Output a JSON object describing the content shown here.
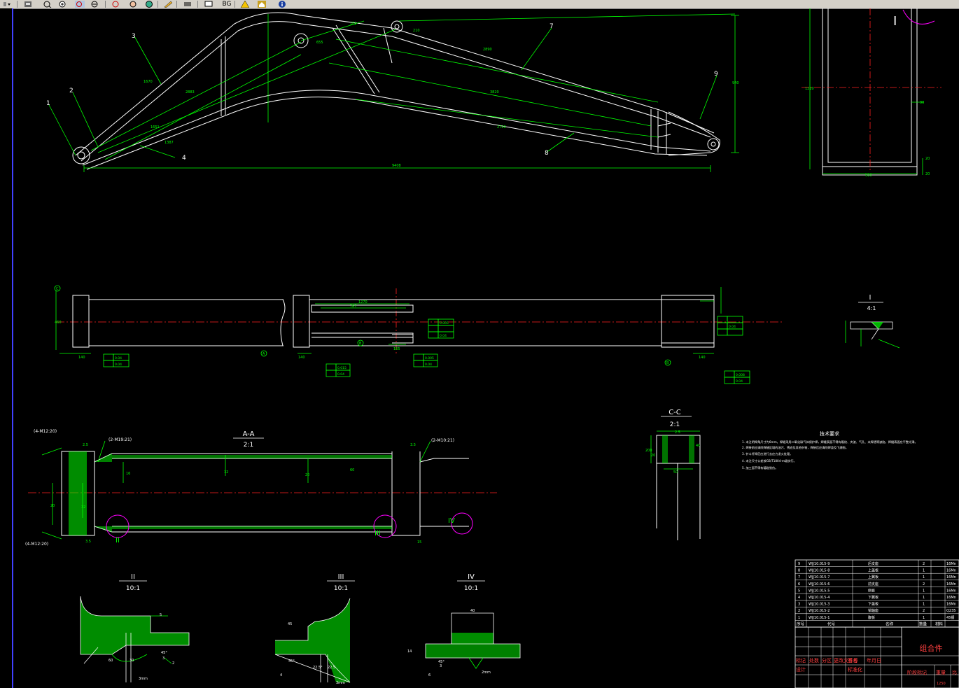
{
  "toolbar": {
    "items": [
      {
        "name": "menu-dropdown-icon"
      },
      {
        "name": "print-icon"
      },
      {
        "name": "zoom-realtime-icon"
      },
      {
        "name": "zoom-in-icon"
      },
      {
        "name": "zoom-window-icon"
      },
      {
        "name": "zoom-previous-icon"
      },
      {
        "name": "zoom-extents-icon"
      },
      {
        "name": "pan-icon"
      },
      {
        "name": "globe-icon"
      },
      {
        "name": "pencil-icon"
      },
      {
        "name": "layers-icon"
      },
      {
        "name": "monitor-icon"
      },
      {
        "name": "bg-button-label",
        "label": "BG"
      },
      {
        "name": "warning-icon"
      },
      {
        "name": "home-icon"
      },
      {
        "name": "info-icon"
      }
    ],
    "colors": {
      "bg": "#d4d0c8",
      "info": "#1a3fa0",
      "home": "#c8a020"
    }
  },
  "drawing": {
    "colors": {
      "line": "#ffffff",
      "dim": "#00ff00",
      "center": "#ff2020",
      "detail": "#ff00ff",
      "label": "#00ff00",
      "title_text": "#ff4040"
    },
    "callouts": [
      "1",
      "2",
      "3",
      "4",
      "7",
      "8",
      "9"
    ],
    "dims_top": [
      "9408",
      "2890",
      "3820",
      "2883",
      "2720",
      "1670",
      "1651",
      "1387",
      "655",
      "940",
      "185",
      "210"
    ],
    "side_view": {
      "roman": "I",
      "dims": [
        "1210",
        "90",
        "20",
        "20",
        "910"
      ]
    },
    "plan": {
      "dims": [
        "1270",
        "787",
        "460",
        "140",
        "140",
        "165",
        "140"
      ],
      "tols": [
        "0.04",
        "0.04",
        "0.015",
        "0.04",
        "0.005",
        "0.04",
        "0.005",
        "0.04",
        "0.04",
        "0.008",
        "0.04"
      ],
      "datums": [
        "A",
        "B",
        "B",
        "C"
      ]
    },
    "detail_I": {
      "title": "I",
      "scale": "4:1"
    },
    "section_AA": {
      "title": "A-A",
      "scale": "2:1",
      "notes": [
        "(4-M12:20)",
        "(2-M19:21)",
        "(2-M10:21)",
        "(4-M12:20)"
      ],
      "markers": [
        "II",
        "III",
        "IV"
      ],
      "dims": [
        "2.5",
        "3.5",
        "3.5",
        "16",
        "20",
        "32",
        "32",
        "20",
        "60",
        "15"
      ]
    },
    "section_CC": {
      "title": "C-C",
      "scale": "2:1",
      "dims": [
        "2.5",
        "200",
        "50",
        "40",
        "20"
      ]
    },
    "detail_II": {
      "title": "II",
      "scale": "10:1",
      "dims": [
        "5",
        "45°",
        "3",
        "2",
        "3mm",
        "60",
        "30"
      ]
    },
    "detail_III": {
      "title": "III",
      "scale": "10:1",
      "dims": [
        "45",
        "45°",
        "22.5°",
        "22.5",
        "3mm",
        "4"
      ]
    },
    "detail_IV": {
      "title": "IV",
      "scale": "10:1",
      "dims": [
        "40",
        "14",
        "45°",
        "3",
        "6",
        "2mm"
      ]
    },
    "tech_notes": {
      "title": "技术要求",
      "lines": [
        "1. 未注明焊角尺寸为6mm，焊缝采用二氧化碳气体保护焊，焊缝表面不得有裂纹、夹渣、气孔、未焊透等缺陷，焊缝表面应平整光滑。",
        "2. 焊接前应清除焊缝区域的油污、锈迹及其他杂物，焊接后应清除焊渣及飞溅物。",
        "3. 铲斗杆焊后应进行去应力退火处理。",
        "4. 未注尺寸公差按GB/T1804-m级执行。",
        "5. 加工面不得有磕碰划伤。"
      ]
    },
    "bom": {
      "rows": [
        [
          "9",
          "WJJ10.015-9",
          "后支座",
          "2",
          "16Mn"
        ],
        [
          "8",
          "WJJ10.015-8",
          "上盖板",
          "1",
          "16Mn"
        ],
        [
          "7",
          "WJJ10.015-7",
          "上翼板",
          "1",
          "16Mn"
        ],
        [
          "6",
          "WJJ10.015-6",
          "前支座",
          "2",
          "16Mn"
        ],
        [
          "5",
          "WJJ10.015-5",
          "侧板",
          "1",
          "16Mn"
        ],
        [
          "4",
          "WJJ10.015-4",
          "下翼板",
          "1",
          "16Mn"
        ],
        [
          "3",
          "WJJ10.015-3",
          "下盖板",
          "1",
          "16Mn"
        ],
        [
          "2",
          "WJJ10.015-2",
          "销轴座",
          "2",
          "Q235"
        ],
        [
          "1",
          "WJJ10.015-1",
          "腹板",
          "1",
          "45钢"
        ]
      ],
      "header": [
        "序号",
        "代号",
        "名称",
        "数量",
        "材料"
      ]
    },
    "title_block": {
      "name": "组合件",
      "row_labels": [
        "标记",
        "处数",
        "分区",
        "更改文件号",
        "签名",
        "年月日"
      ],
      "row2": [
        "设计",
        "",
        "标准化"
      ],
      "row3": [
        "阶段标记",
        "重量",
        "比"
      ],
      "values": [
        "1250"
      ]
    }
  }
}
